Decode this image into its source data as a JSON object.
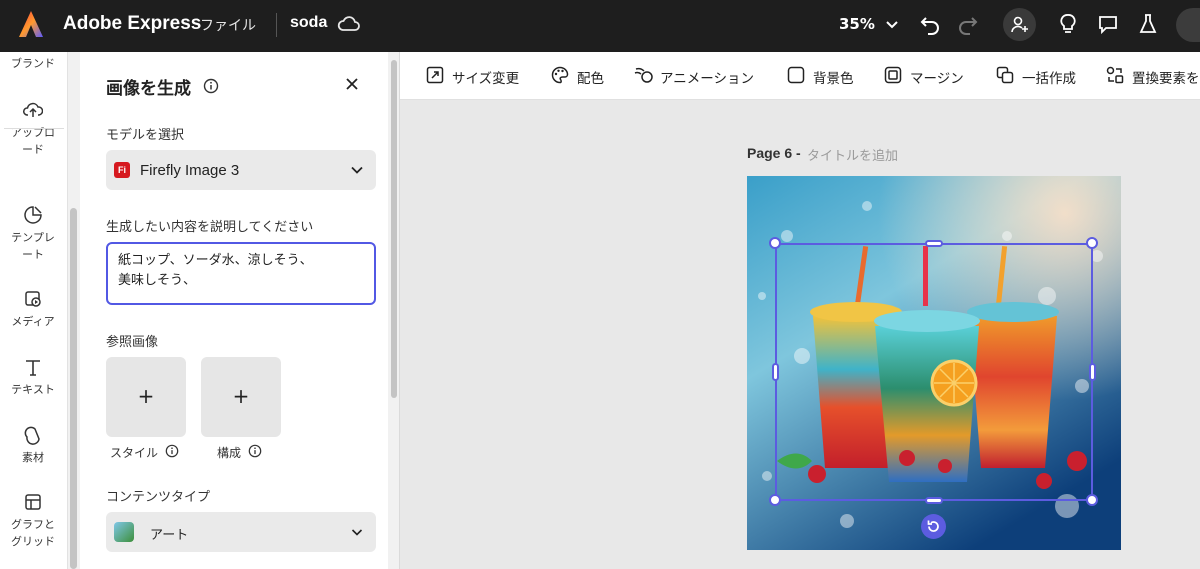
{
  "topbar": {
    "app_name": "Adobe Express",
    "file_menu": "ファイル",
    "doc_name": "soda",
    "zoom": "35%"
  },
  "rail": {
    "items": [
      {
        "label": "ブランド",
        "icon": "brand-icon"
      },
      {
        "label": "アップロード",
        "icon": "upload-icon"
      },
      {
        "label": "テンプレート",
        "icon": "template-icon"
      },
      {
        "label": "メディア",
        "icon": "media-icon"
      },
      {
        "label": "テキスト",
        "icon": "text-icon"
      },
      {
        "label": "素材",
        "icon": "elements-icon"
      },
      {
        "label": "グラフとグリッド",
        "icon": "grid-icon"
      }
    ]
  },
  "panel": {
    "title": "画像を生成",
    "model_label": "モデルを選択",
    "model_value": "Firefly Image 3",
    "model_badge": "Fi",
    "prompt_label": "生成したい内容を説明してください",
    "prompt_value": "紙コップ、ソーダ水、涼しそう、\n美味しそう、",
    "reference_label": "参照画像",
    "ref_style_caption": "スタイル",
    "ref_composition_caption": "構成",
    "ref_add": "+",
    "content_type_label": "コンテンツタイプ",
    "content_type_value": "アート"
  },
  "toolbar": {
    "resize": "サイズ変更",
    "color": "配色",
    "animation": "アニメーション",
    "background": "背景色",
    "margin": "マージン",
    "batch": "一括作成",
    "replace": "置換要素を"
  },
  "canvas": {
    "page_label": "Page 6 -",
    "page_title_placeholder": "タイトルを追加"
  },
  "colors": {
    "selection": "#5c5ce0",
    "topbar_bg": "#1e1e1e",
    "prompt_border": "#5258e4"
  }
}
